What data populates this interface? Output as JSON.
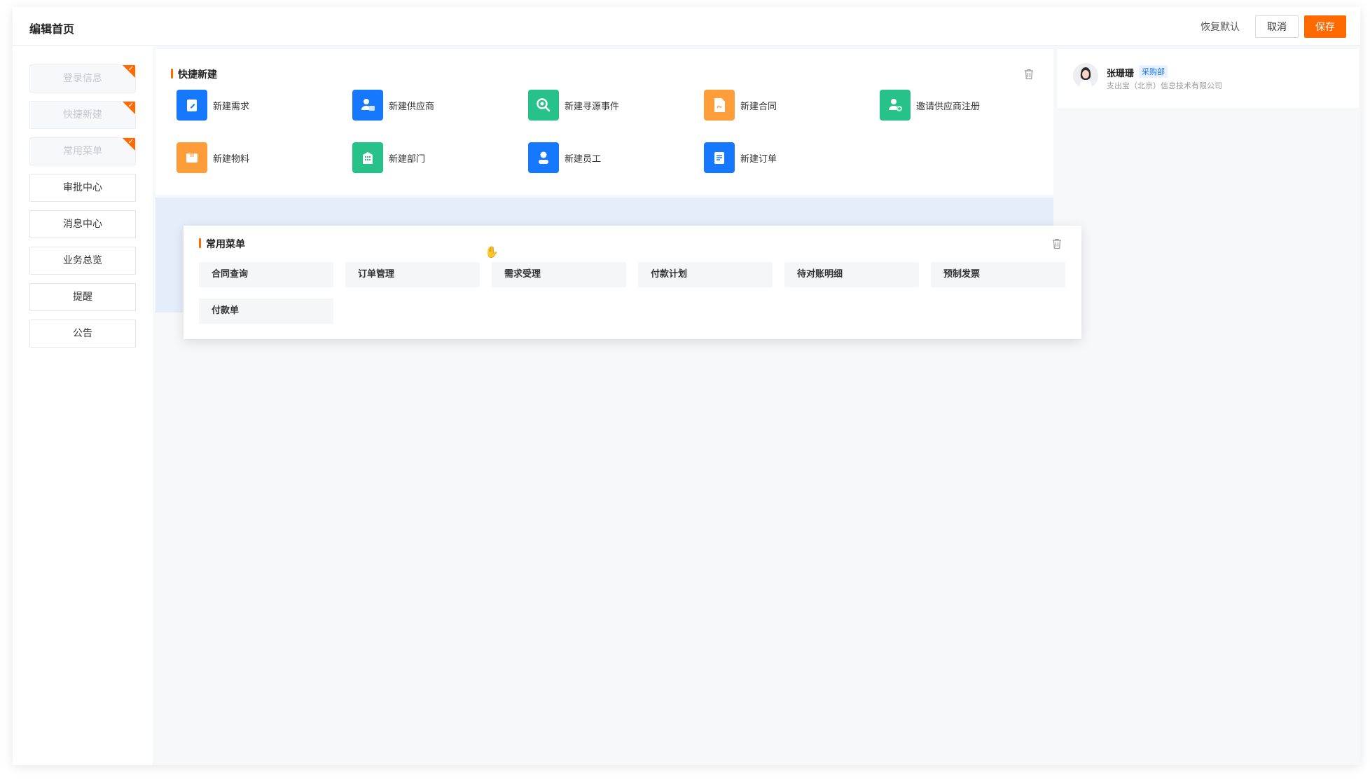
{
  "header": {
    "title": "编辑首页",
    "restore_label": "恢复默认",
    "cancel_label": "取消",
    "save_label": "保存"
  },
  "sidebar": {
    "items": [
      {
        "label": "登录信息",
        "state": "added"
      },
      {
        "label": "快捷新建",
        "state": "added"
      },
      {
        "label": "常用菜单",
        "state": "added"
      },
      {
        "label": "审批中心",
        "state": "available"
      },
      {
        "label": "消息中心",
        "state": "available"
      },
      {
        "label": "业务总览",
        "state": "available"
      },
      {
        "label": "提醒",
        "state": "available"
      },
      {
        "label": "公告",
        "state": "available"
      }
    ]
  },
  "quick_create": {
    "title": "快捷新建",
    "items": [
      {
        "label": "新建需求",
        "icon": "edit-doc-icon",
        "color": "#1677ff"
      },
      {
        "label": "新建供应商",
        "icon": "supplier-icon",
        "color": "#1677ff"
      },
      {
        "label": "新建寻源事件",
        "icon": "search-icon",
        "color": "#27c28a"
      },
      {
        "label": "新建合同",
        "icon": "contract-icon",
        "color": "#ff9d3a"
      },
      {
        "label": "邀请供应商注册",
        "icon": "invite-user-icon",
        "color": "#27c28a"
      },
      {
        "label": "新建物料",
        "icon": "box-icon",
        "color": "#ff9d3a"
      },
      {
        "label": "新建部门",
        "icon": "building-icon",
        "color": "#27c28a"
      },
      {
        "label": "新建员工",
        "icon": "user-icon",
        "color": "#1677ff"
      },
      {
        "label": "新建订单",
        "icon": "order-icon",
        "color": "#1677ff"
      }
    ]
  },
  "common_menu": {
    "title": "常用菜单",
    "items": [
      "合同查询",
      "订单管理",
      "需求受理",
      "付款计划",
      "待对账明细",
      "预制发票",
      "付款单"
    ]
  },
  "profile": {
    "name": "张珊珊",
    "department": "采购部",
    "company": "支出宝（北京）信息技术有限公司"
  },
  "colors": {
    "accent": "#ff6a00",
    "primary_blue": "#1677ff",
    "green": "#27c28a",
    "orange": "#ff9d3a"
  }
}
